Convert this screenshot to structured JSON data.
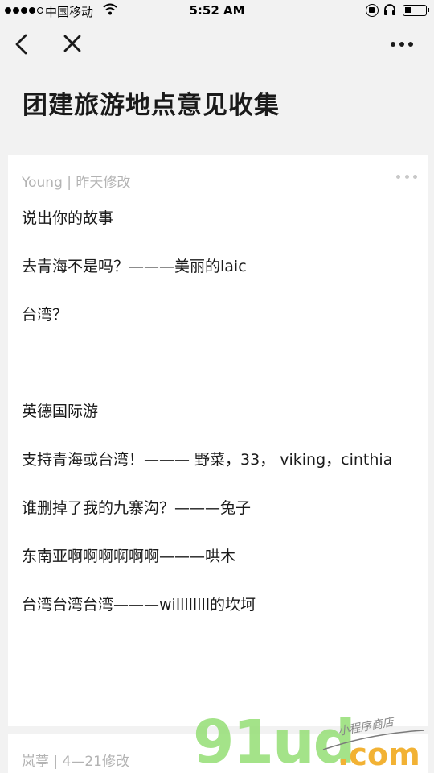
{
  "status_bar": {
    "carrier": "中国移动",
    "time": "5:52 AM",
    "signal_strength": 4,
    "signal_max": 5
  },
  "nav": {
    "icons": [
      "back-icon",
      "close-icon",
      "more-icon"
    ]
  },
  "page_title": "团建旅游地点意见收集",
  "cards": [
    {
      "meta": "Young | 昨天修改",
      "lines": [
        "说出你的故事",
        "",
        "去青海不是吗？———美丽的laic",
        "",
        "台湾？",
        "",
        "",
        "",
        "英德国际游",
        "",
        "支持青海或台湾！——— 野菜，33，  viking，cinthia",
        "",
        "谁删掉了我的九寨沟？———兔子",
        "",
        "东南亚啊啊啊啊啊啊———哄木",
        "",
        "台湾台湾台湾———willllllll的坎坷"
      ]
    },
    {
      "meta": "岚葶 | 4—21修改"
    }
  ],
  "watermark": {
    "logo": "91ud",
    "domain": ".com",
    "tagline": "小程序商店"
  }
}
